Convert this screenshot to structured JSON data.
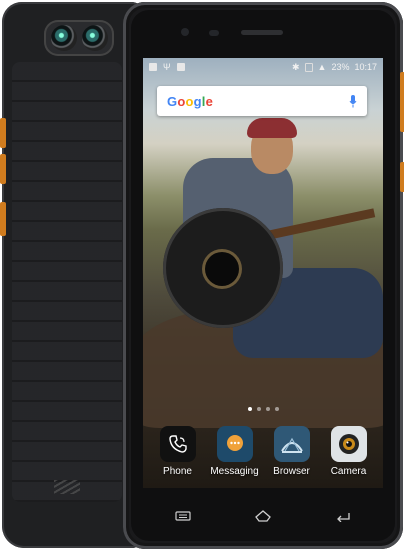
{
  "status_bar": {
    "left_icons": [
      "image-icon",
      "usb-icon",
      "notification-icon"
    ],
    "battery": "23%",
    "time": "10:17",
    "right_icons": [
      "bluetooth-icon",
      "no-sim-icon",
      "battery-saver-icon"
    ]
  },
  "search": {
    "logo_letters": [
      "G",
      "o",
      "o",
      "g",
      "l",
      "e"
    ],
    "logo_colors": [
      "#4285f4",
      "#ea4335",
      "#fbbc05",
      "#4285f4",
      "#34a853",
      "#ea4335"
    ],
    "mic_color": "#4285f4"
  },
  "home": {
    "page_count": 4,
    "active_page": 1
  },
  "dock": [
    {
      "label": "Phone",
      "icon": "phone-icon"
    },
    {
      "label": "Messaging",
      "icon": "messaging-icon"
    },
    {
      "label": "Browser",
      "icon": "browser-icon"
    },
    {
      "label": "Camera",
      "icon": "camera-icon"
    }
  ],
  "nav": {
    "icons": [
      "recent-apps-icon",
      "home-icon",
      "back-icon"
    ]
  },
  "colors": {
    "accent_orange": "#d07c1e",
    "body": "#1f2022"
  }
}
